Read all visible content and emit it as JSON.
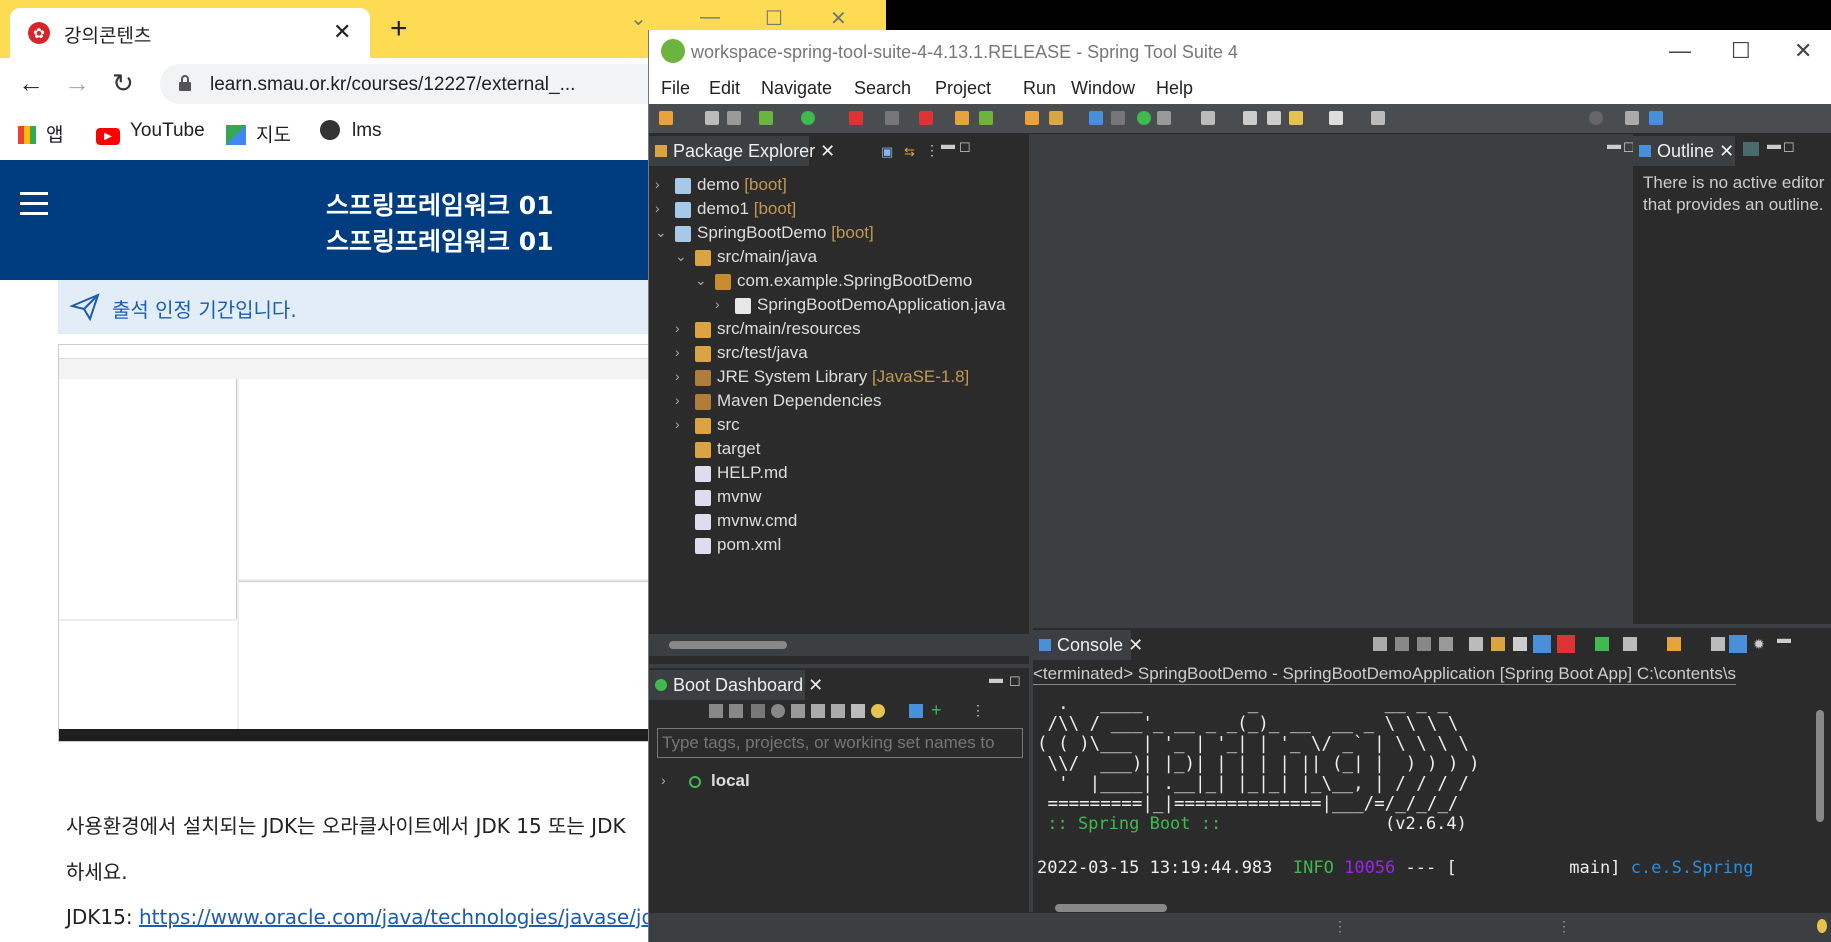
{
  "browser": {
    "tab_title": "강의콘텐츠",
    "tab_close": "✕",
    "new_tab": "+",
    "url": "learn.smau.or.kr/courses/12227/external_...",
    "bookmarks": [
      {
        "label": "앱",
        "icon": "apps-grid-icon"
      },
      {
        "label": "YouTube",
        "icon": "youtube-icon"
      },
      {
        "label": "지도",
        "icon": "maps-icon"
      },
      {
        "label": "lms",
        "icon": "globe-icon"
      }
    ]
  },
  "page": {
    "course_title_1": "스프링프레임워크 01",
    "course_title_2": "스프링프레임워크 01",
    "notice": "출석 인정 기간입니다.",
    "paragraph_1": "사용환경에서 설치되는 JDK는 오라클사이트에서 JDK 15 또는 JDK",
    "paragraph_2": "하세요.",
    "jdk_label": "JDK15: ",
    "jdk_link": "https://www.oracle.com/java/technologies/javase/jd"
  },
  "ide": {
    "window_title": "workspace-spring-tool-suite-4-4.13.1.RELEASE - Spring Tool Suite 4",
    "menu": [
      "File",
      "Edit",
      "Navigate",
      "Search",
      "Project",
      "Run",
      "Window",
      "Help"
    ],
    "package_explorer": {
      "tab": "Package Explorer",
      "items": [
        {
          "label": "demo",
          "suffix": "[boot]",
          "indent": 0,
          "arrow": "›",
          "icon": "project-icon"
        },
        {
          "label": "demo1",
          "suffix": "[boot]",
          "indent": 0,
          "arrow": "›",
          "icon": "project-icon"
        },
        {
          "label": "SpringBootDemo",
          "suffix": "[boot]",
          "indent": 0,
          "arrow": "⌄",
          "icon": "project-icon"
        },
        {
          "label": "src/main/java",
          "suffix": "",
          "indent": 1,
          "arrow": "⌄",
          "icon": "source-folder-icon"
        },
        {
          "label": "com.example.SpringBootDemo",
          "suffix": "",
          "indent": 2,
          "arrow": "⌄",
          "icon": "package-icon"
        },
        {
          "label": "SpringBootDemoApplication.java",
          "suffix": "",
          "indent": 3,
          "arrow": "›",
          "icon": "java-file-icon"
        },
        {
          "label": "src/main/resources",
          "suffix": "",
          "indent": 1,
          "arrow": "›",
          "icon": "source-folder-icon"
        },
        {
          "label": "src/test/java",
          "suffix": "",
          "indent": 1,
          "arrow": "›",
          "icon": "source-folder-icon"
        },
        {
          "label": "JRE System Library",
          "suffix": "[JavaSE-1.8]",
          "indent": 1,
          "arrow": "›",
          "icon": "library-icon"
        },
        {
          "label": "Maven Dependencies",
          "suffix": "",
          "indent": 1,
          "arrow": "›",
          "icon": "library-icon"
        },
        {
          "label": "src",
          "suffix": "",
          "indent": 1,
          "arrow": "›",
          "icon": "folder-icon"
        },
        {
          "label": "target",
          "suffix": "",
          "indent": 1,
          "arrow": "",
          "icon": "folder-icon"
        },
        {
          "label": "HELP.md",
          "suffix": "",
          "indent": 1,
          "arrow": "",
          "icon": "file-icon"
        },
        {
          "label": "mvnw",
          "suffix": "",
          "indent": 1,
          "arrow": "",
          "icon": "file-icon"
        },
        {
          "label": "mvnw.cmd",
          "suffix": "",
          "indent": 1,
          "arrow": "",
          "icon": "file-icon"
        },
        {
          "label": "pom.xml",
          "suffix": "",
          "indent": 1,
          "arrow": "",
          "icon": "xml-file-icon"
        }
      ]
    },
    "outline": {
      "tab": "Outline",
      "message": "There is no active editor that provides an outline."
    },
    "boot_dashboard": {
      "tab": "Boot Dashboard",
      "placeholder": "Type tags, projects, or working set names to",
      "local": "local"
    },
    "console": {
      "tab": "Console",
      "path": "<terminated> SpringBootDemo - SpringBootDemoApplication [Spring Boot App] C:\\contents\\s",
      "banner": "  .   ____          _            __ _ _\n /\\\\ / ___'_ __ _ _(_)_ __  __ _ \\ \\ \\ \\\n( ( )\\___ | '_ | '_| | '_ \\/ _` | \\ \\ \\ \\\n \\\\/  ___)| |_)| | | | | || (_| |  ) ) ) )\n  '  |____| .__|_| |_|_| |_\\__, | / / / /\n =========|_|==============|___/=/_/_/_/",
      "boot_label": " :: Spring Boot :: ",
      "boot_version": "(v2.6.4)",
      "log_time": "2022-03-15 13:19:44.983",
      "log_level": "INFO",
      "log_pid": "10056",
      "log_rest": " --- [           main] ",
      "log_class": "c.e.S.Spring"
    }
  },
  "colors": {
    "chrome_yellow": "#fddc53",
    "site_blue": "#003d80",
    "ide_dark": "#2b2b2b",
    "boot_tag": "#c09853",
    "spring_green": "#6db33f"
  }
}
